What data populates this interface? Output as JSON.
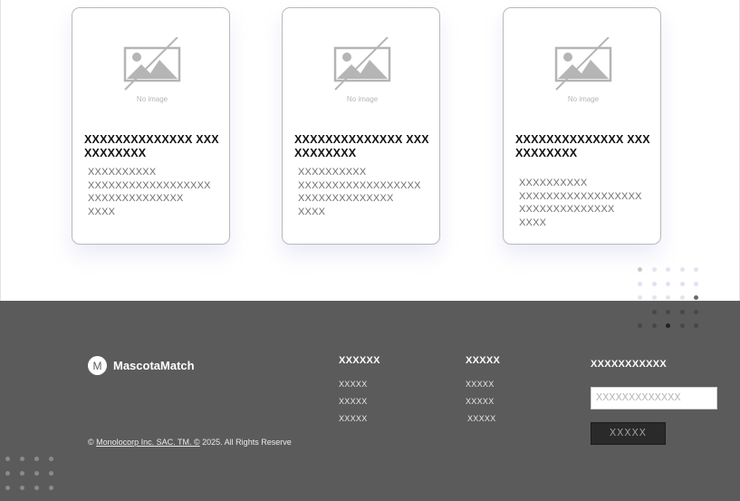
{
  "cards": [
    {
      "image_label": "No image",
      "title": "XXXXXXXXXXXXXX XXXXXXXXXXX",
      "description": "XXXXXXXXXX\nXXXXXXXXXXXXXXXXXX\nXXXXXXXXXXXXXX\nXXXX"
    },
    {
      "image_label": "No image",
      "title": "XXXXXXXXXXXXXX XXXXXXXXXXX",
      "description": "XXXXXXXXXX\nXXXXXXXXXXXXXXXXXX\nXXXXXXXXXXXXXX\nXXXX"
    },
    {
      "image_label": "No image",
      "title": "XXXXXXXXXXXXXX XXXXXXXXXXX",
      "description": "XXXXXXXXXX\nXXXXXXXXXXXXXXXXXX\nXXXXXXXXXXXXXX\nXXXX"
    }
  ],
  "footer": {
    "brand_initial": "M",
    "brand_name": "MascotaMatch",
    "copyright_prefix": "© ",
    "copyright_company": "Monolocorp Inc. SAC. TM. ©",
    "copyright_suffix": " 2025. All Rights Reserve",
    "col1": {
      "heading": "XXXXXX",
      "links": [
        "XXXXX",
        "XXXXX",
        "XXXXX"
      ]
    },
    "col2": {
      "heading": "XXXXX",
      "links": [
        "XXXXX",
        "XXXXX",
        "XXXXX"
      ]
    },
    "newsletter": {
      "heading": "XXXXXXXXXXX",
      "placeholder": "XXXXXXXXXXXXX",
      "button_label": "XXXXX"
    }
  },
  "colors": {
    "footer_bg": "#5b5b5b",
    "button_bg": "#2a2a2a"
  }
}
